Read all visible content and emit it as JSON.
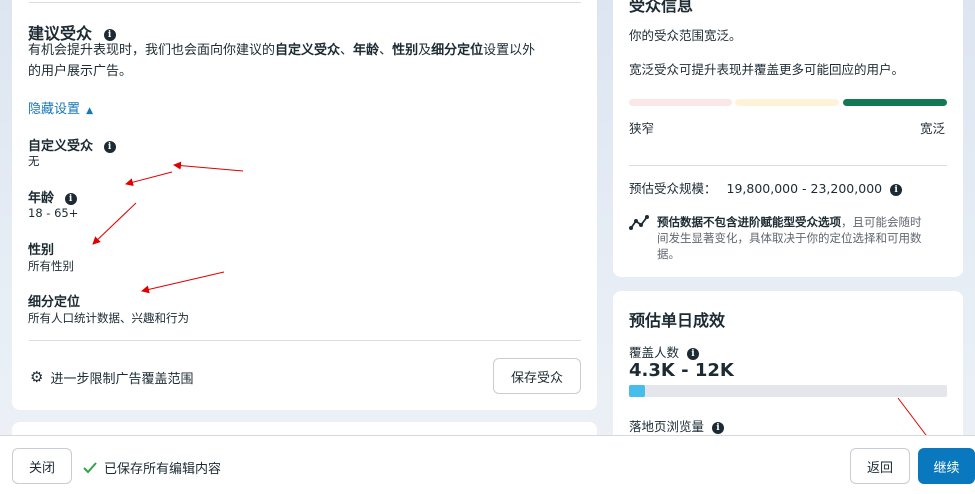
{
  "suggested_audience": {
    "title": "建议受众",
    "desc_plain_1": "有机会提升表现时，我们也会面向你建议的",
    "desc_bold_1": "自定义受众",
    "desc_sep_1": "、",
    "desc_bold_2": "年龄",
    "desc_sep_2": "、",
    "desc_bold_3": "性别",
    "desc_sep_3": "及",
    "desc_bold_4": "细分定位",
    "desc_plain_2": "设置以外",
    "desc_line2": "的用户展示广告。",
    "hide_settings": "隐藏设置",
    "custom_audience_label": "自定义受众",
    "custom_audience_value": "无",
    "age_label": "年龄",
    "age_value": "18 - 65+",
    "gender_label": "性别",
    "gender_value": "所有性别",
    "detailed_targeting_label": "细分定位",
    "detailed_targeting_value": "所有人口统计数据、兴趣和行为",
    "further_limit": "进一步限制广告覆盖范围",
    "save_audience": "保存受众"
  },
  "audience_definition": {
    "title": "受众信息",
    "line1": "你的受众范围宽泛。",
    "line2": "宽泛受众可提升表现并覆盖更多可能回应的用户。",
    "narrow_label": "狭窄",
    "broad_label": "宽泛",
    "meter_level": "broad",
    "estimated_size_label": "预估受众规模：",
    "estimated_size_value": "19,800,000 - 23,200,000",
    "note_bold": "预估数据不包含进阶赋能型受众选项",
    "note_rest_1": "，且可能会随时",
    "note_line2": "间发生显著变化，具体取决于你的定位选择和可用数",
    "note_line3": "据。"
  },
  "daily_results": {
    "title": "预估单日成效",
    "reach_label": "覆盖人数",
    "reach_value": "4.3K - 12K",
    "reach_progress": 0.05,
    "landing_page_label": "落地页浏览量"
  },
  "footer": {
    "close": "关闭",
    "saved_status": "已保存所有编辑内容",
    "back": "返回",
    "continue": "继续"
  },
  "colors": {
    "primary": "#0a78be",
    "link": "#1877b8",
    "meter_narrow": "#fbe6e8",
    "meter_mid": "#fdf3d9",
    "meter_broad": "#127955",
    "reach_bar": "#47bdec",
    "success_check": "#31a24c",
    "annotation_arrow": "#e00000"
  }
}
